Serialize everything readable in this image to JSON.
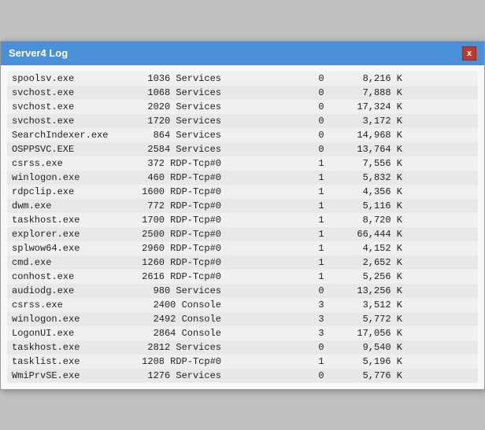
{
  "window": {
    "title": "Server4 Log",
    "close_label": "x"
  },
  "rows": [
    {
      "process": "spoolsv.exe",
      "pid": "1036",
      "session": "Services",
      "session_num": "0",
      "memory": "8,216 K"
    },
    {
      "process": "svchost.exe",
      "pid": "1068",
      "session": "Services",
      "session_num": "0",
      "memory": "7,888 K"
    },
    {
      "process": "svchost.exe",
      "pid": "2020",
      "session": "Services",
      "session_num": "0",
      "memory": "17,324 K"
    },
    {
      "process": "svchost.exe",
      "pid": "1720",
      "session": "Services",
      "session_num": "0",
      "memory": "3,172 K"
    },
    {
      "process": "SearchIndexer.exe",
      "pid": "864",
      "session": "Services",
      "session_num": "0",
      "memory": "14,968 K"
    },
    {
      "process": "OSPPSVC.EXE",
      "pid": "2584",
      "session": "Services",
      "session_num": "0",
      "memory": "13,764 K"
    },
    {
      "process": "csrss.exe",
      "pid": "372",
      "session": "RDP-Tcp#0",
      "session_num": "1",
      "memory": "7,556 K"
    },
    {
      "process": "winlogon.exe",
      "pid": "460",
      "session": "RDP-Tcp#0",
      "session_num": "1",
      "memory": "5,832 K"
    },
    {
      "process": "rdpclip.exe",
      "pid": "1600",
      "session": "RDP-Tcp#0",
      "session_num": "1",
      "memory": "4,356 K"
    },
    {
      "process": "dwm.exe",
      "pid": "772",
      "session": "RDP-Tcp#0",
      "session_num": "1",
      "memory": "5,116 K"
    },
    {
      "process": "taskhost.exe",
      "pid": "1700",
      "session": "RDP-Tcp#0",
      "session_num": "1",
      "memory": "8,720 K"
    },
    {
      "process": "explorer.exe",
      "pid": "2500",
      "session": "RDP-Tcp#0",
      "session_num": "1",
      "memory": "66,444 K"
    },
    {
      "process": "splwow64.exe",
      "pid": "2960",
      "session": "RDP-Tcp#0",
      "session_num": "1",
      "memory": "4,152 K"
    },
    {
      "process": "cmd.exe",
      "pid": "1260",
      "session": "RDP-Tcp#0",
      "session_num": "1",
      "memory": "2,652 K"
    },
    {
      "process": "conhost.exe",
      "pid": "2616",
      "session": "RDP-Tcp#0",
      "session_num": "1",
      "memory": "5,256 K"
    },
    {
      "process": "audiodg.exe",
      "pid": "980",
      "session": "Services",
      "session_num": "0",
      "memory": "13,256 K"
    },
    {
      "process": "csrss.exe",
      "pid": "2400",
      "session": "Console",
      "session_num": "3",
      "memory": "3,512 K"
    },
    {
      "process": "winlogon.exe",
      "pid": "2492",
      "session": "Console",
      "session_num": "3",
      "memory": "5,772 K"
    },
    {
      "process": "LogonUI.exe",
      "pid": "2864",
      "session": "Console",
      "session_num": "3",
      "memory": "17,056 K"
    },
    {
      "process": "taskhost.exe",
      "pid": "2812",
      "session": "Services",
      "session_num": "0",
      "memory": "9,540 K"
    },
    {
      "process": "tasklist.exe",
      "pid": "1208",
      "session": "RDP-Tcp#0",
      "session_num": "1",
      "memory": "5,196 K"
    },
    {
      "process": "WmiPrvSE.exe",
      "pid": "1276",
      "session": "Services",
      "session_num": "0",
      "memory": "5,776 K"
    }
  ]
}
